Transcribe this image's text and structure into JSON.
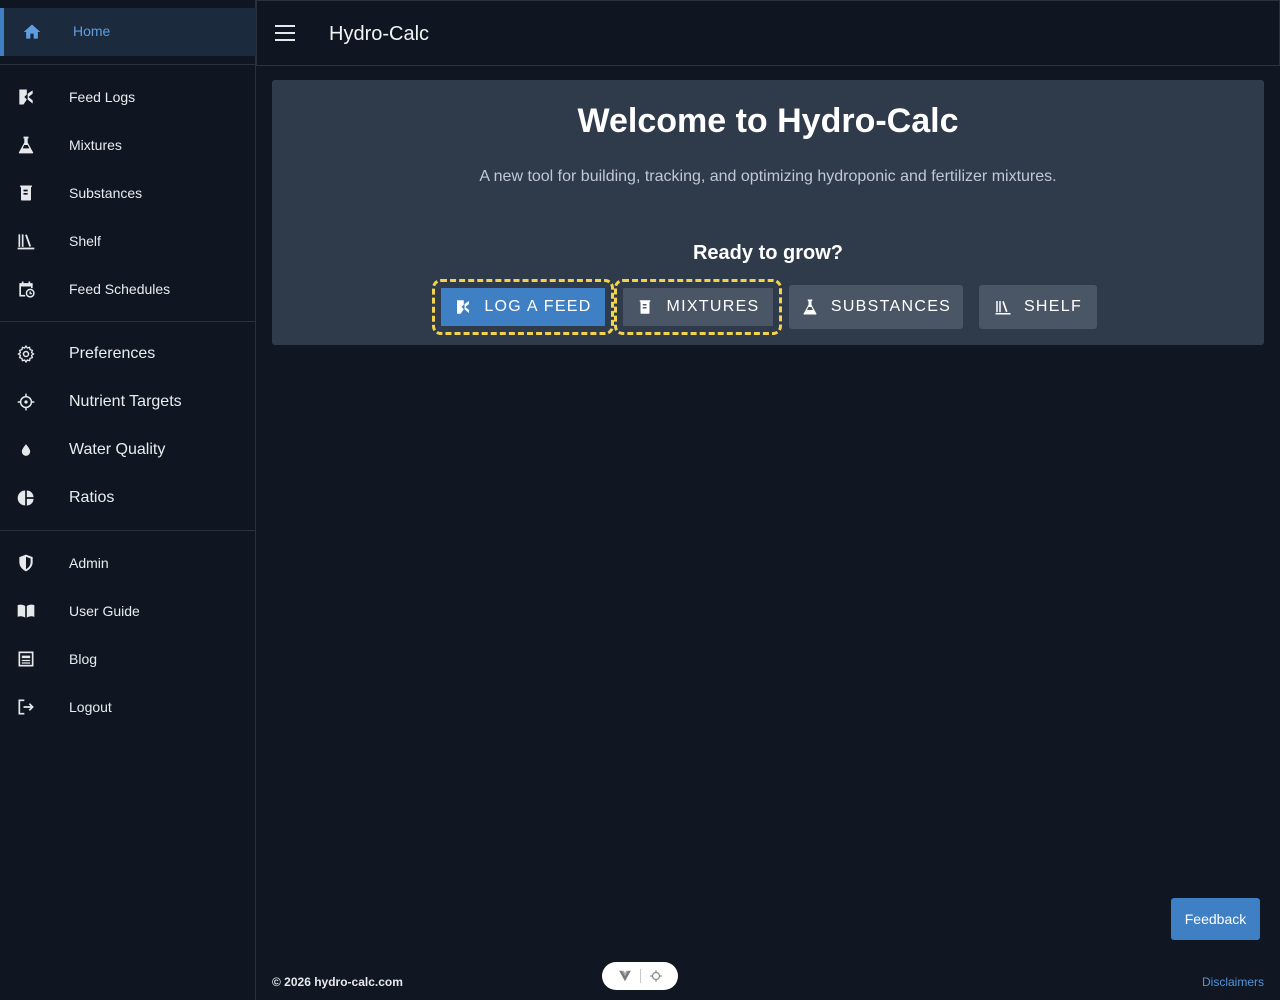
{
  "app": {
    "title": "Hydro-Calc"
  },
  "sidebar": {
    "home": {
      "label": "Home",
      "icon": "home-icon"
    },
    "group1": [
      {
        "label": "Feed Logs",
        "icon": "feed-log-icon"
      },
      {
        "label": "Mixtures",
        "icon": "flask-icon"
      },
      {
        "label": "Substances",
        "icon": "beaker-icon"
      },
      {
        "label": "Shelf",
        "icon": "shelf-icon"
      },
      {
        "label": "Feed Schedules",
        "icon": "calendar-clock-icon"
      }
    ],
    "group2": [
      {
        "label": "Preferences",
        "icon": "gear-icon"
      },
      {
        "label": "Nutrient Targets",
        "icon": "crosshair-icon"
      },
      {
        "label": "Water Quality",
        "icon": "water-drop-icon"
      },
      {
        "label": "Ratios",
        "icon": "pie-chart-icon"
      }
    ],
    "group3": [
      {
        "label": "Admin",
        "icon": "shield-icon"
      },
      {
        "label": "User Guide",
        "icon": "book-icon"
      },
      {
        "label": "Blog",
        "icon": "newspaper-icon"
      },
      {
        "label": "Logout",
        "icon": "logout-icon"
      }
    ]
  },
  "main": {
    "welcome_title": "Welcome to Hydro-Calc",
    "subtitle": "A new tool for building, tracking, and optimizing hydroponic and fertilizer mixtures.",
    "ready": "Ready to grow?",
    "buttons": {
      "log_feed": "LOG A FEED",
      "mixtures": "MIXTURES",
      "substances": "SUBSTANCES",
      "shelf": "SHELF"
    }
  },
  "footer": {
    "copyright": "© 2026 hydro-calc.com",
    "disclaimers": "Disclaimers",
    "feedback": "Feedback"
  },
  "colors": {
    "accent": "#3f7fc4",
    "highlight": "#f2d34b",
    "card": "#2f3a4b",
    "background": "#111722"
  }
}
